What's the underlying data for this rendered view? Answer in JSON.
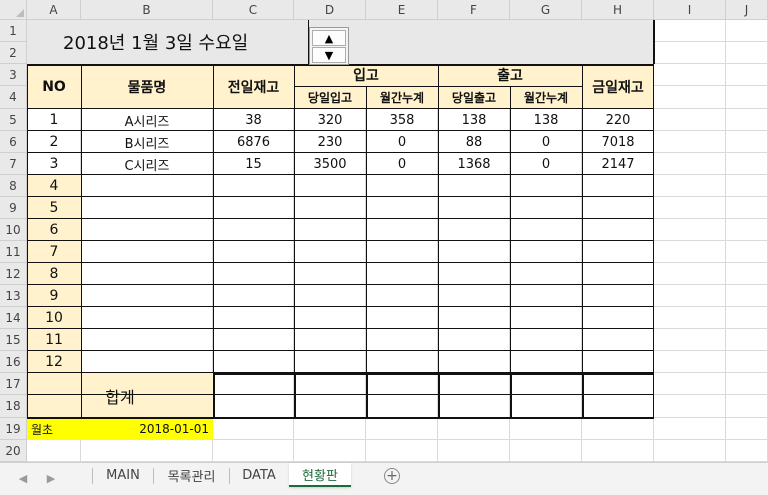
{
  "columns": [
    "A",
    "B",
    "C",
    "D",
    "E",
    "F",
    "G",
    "H",
    "I",
    "J"
  ],
  "rows": [
    "1",
    "2",
    "3",
    "4",
    "5",
    "6",
    "7",
    "8",
    "9",
    "10",
    "11",
    "12",
    "13",
    "14",
    "15",
    "16",
    "17",
    "18",
    "19",
    "20"
  ],
  "title": "2018년 1월 3일 수요일",
  "headers": {
    "no": "NO",
    "item": "물품명",
    "prev_stock": "전일재고",
    "in": "입고",
    "out": "출고",
    "today_stock": "금일재고",
    "daily_in": "당일입고",
    "monthly_in": "월간누계",
    "daily_out": "당일출고",
    "monthly_out": "월간누계"
  },
  "table_rows": [
    {
      "no": "1",
      "item": "A시리즈",
      "prev": "38",
      "din": "320",
      "min": "358",
      "dout": "138",
      "mout": "138",
      "today": "220"
    },
    {
      "no": "2",
      "item": "B시리즈",
      "prev": "6876",
      "din": "230",
      "min": "0",
      "dout": "88",
      "mout": "0",
      "today": "7018"
    },
    {
      "no": "3",
      "item": "C시리즈",
      "prev": "15",
      "din": "3500",
      "min": "0",
      "dout": "1368",
      "mout": "0",
      "today": "2147"
    },
    {
      "no": "4",
      "item": "",
      "prev": "",
      "din": "",
      "min": "",
      "dout": "",
      "mout": "",
      "today": ""
    },
    {
      "no": "5",
      "item": "",
      "prev": "",
      "din": "",
      "min": "",
      "dout": "",
      "mout": "",
      "today": ""
    },
    {
      "no": "6",
      "item": "",
      "prev": "",
      "din": "",
      "min": "",
      "dout": "",
      "mout": "",
      "today": ""
    },
    {
      "no": "7",
      "item": "",
      "prev": "",
      "din": "",
      "min": "",
      "dout": "",
      "mout": "",
      "today": ""
    },
    {
      "no": "8",
      "item": "",
      "prev": "",
      "din": "",
      "min": "",
      "dout": "",
      "mout": "",
      "today": ""
    },
    {
      "no": "9",
      "item": "",
      "prev": "",
      "din": "",
      "min": "",
      "dout": "",
      "mout": "",
      "today": ""
    },
    {
      "no": "10",
      "item": "",
      "prev": "",
      "din": "",
      "min": "",
      "dout": "",
      "mout": "",
      "today": ""
    },
    {
      "no": "11",
      "item": "",
      "prev": "",
      "din": "",
      "min": "",
      "dout": "",
      "mout": "",
      "today": ""
    },
    {
      "no": "12",
      "item": "",
      "prev": "",
      "din": "",
      "min": "",
      "dout": "",
      "mout": "",
      "today": ""
    }
  ],
  "total_label": "합계",
  "month_start": {
    "label": "월초",
    "value": "2018-01-01"
  },
  "spinner": {
    "up_icon": "▲",
    "down_icon": "▼"
  },
  "sheet_tabs": [
    "MAIN",
    "목록관리",
    "DATA",
    "현황판"
  ],
  "active_tab": "현황판",
  "add_sheet_icon": "+",
  "colors": {
    "header_fill": "#fff2cc",
    "title_fill": "#e8e8e8",
    "month_start_fill": "#ffff00",
    "active_tab_text": "#1e6b3a"
  }
}
